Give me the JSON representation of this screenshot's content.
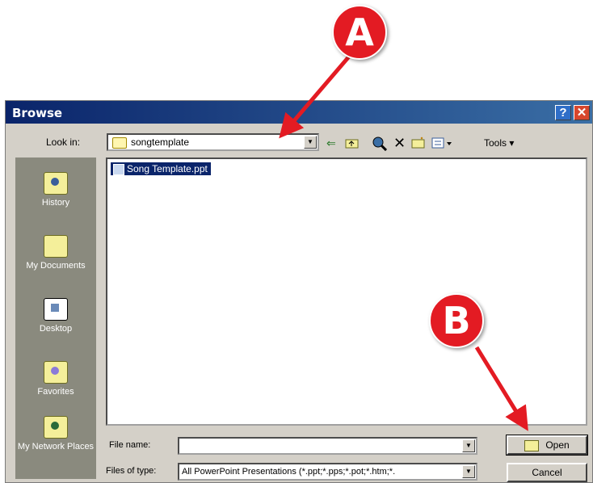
{
  "dialog": {
    "title": "Browse",
    "help_glyph": "?",
    "close_glyph": "✕"
  },
  "look_in": {
    "label": "Look in:",
    "value": "songtemplate"
  },
  "toolbar": {
    "icons": [
      "back-icon",
      "up-folder-icon",
      "search-web-icon",
      "delete-icon",
      "new-folder-icon",
      "views-icon"
    ],
    "tools_label": "Tools"
  },
  "places_bar": {
    "items": [
      {
        "label": "History",
        "icon": "history-icon"
      },
      {
        "label": "My Documents",
        "icon": "my-documents-icon"
      },
      {
        "label": "Desktop",
        "icon": "desktop-icon"
      },
      {
        "label": "Favorites",
        "icon": "favorites-icon"
      },
      {
        "label": "My Network Places",
        "icon": "network-places-icon"
      }
    ]
  },
  "files": [
    {
      "name": "Song Template.ppt",
      "selected": true
    }
  ],
  "file_name": {
    "label": "File name:",
    "value": ""
  },
  "files_of_type": {
    "label": "Files of type:",
    "value": "All PowerPoint Presentations (*.ppt;*.pps;*.pot;*.htm;*."
  },
  "buttons": {
    "open": "Open",
    "cancel": "Cancel"
  },
  "callouts": {
    "a": "A",
    "b": "B",
    "color": "#e31b23"
  }
}
